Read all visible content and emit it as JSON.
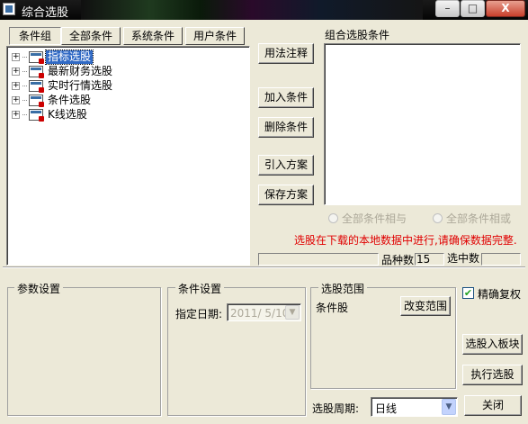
{
  "window": {
    "title": "综合选股"
  },
  "titlebar_buttons": {
    "minimize": "–",
    "maximize": "□",
    "close": "X"
  },
  "tabs": [
    {
      "label": "条件组",
      "active": true
    },
    {
      "label": "全部条件",
      "active": false
    },
    {
      "label": "系统条件",
      "active": false
    },
    {
      "label": "用户条件",
      "active": false
    }
  ],
  "tree": [
    {
      "label": "指标选股",
      "selected": true
    },
    {
      "label": "最新财务选股",
      "selected": false
    },
    {
      "label": "实时行情选股",
      "selected": false
    },
    {
      "label": "条件选股",
      "selected": false
    },
    {
      "label": "K线选股",
      "selected": false
    }
  ],
  "tree_expander": "+",
  "actions": {
    "usage": "用法注释",
    "add": "加入条件",
    "delete": "删除条件",
    "import": "引入方案",
    "save": "保存方案"
  },
  "combo_conditions": {
    "title": "组合选股条件"
  },
  "logic": {
    "and_label": "全部条件相与",
    "or_label": "全部条件相或"
  },
  "warning": {
    "text": "选股在下载的本地数据中进行,请确保数据完整.",
    "color": "#e00000"
  },
  "stats": {
    "count_label": "品种数",
    "count_value": "15",
    "selected_label": "选中数",
    "selected_value": ""
  },
  "params": {
    "title": "参数设置"
  },
  "cond_settings": {
    "title": "条件设置",
    "date_label": "指定日期:",
    "date_value": "2011/ 5/10"
  },
  "range": {
    "title": "选股范围",
    "value": "条件股",
    "change_button": "改变范围"
  },
  "options": {
    "accurate_rights_label": "精确复权",
    "accurate_rights_checked": true,
    "check_glyph": "✔"
  },
  "bottom_buttons": {
    "to_block": "选股入板块",
    "run": "执行选股",
    "close": "关闭"
  },
  "period": {
    "label": "选股周期:",
    "value": "日线"
  },
  "arrow_glyph": "▼"
}
